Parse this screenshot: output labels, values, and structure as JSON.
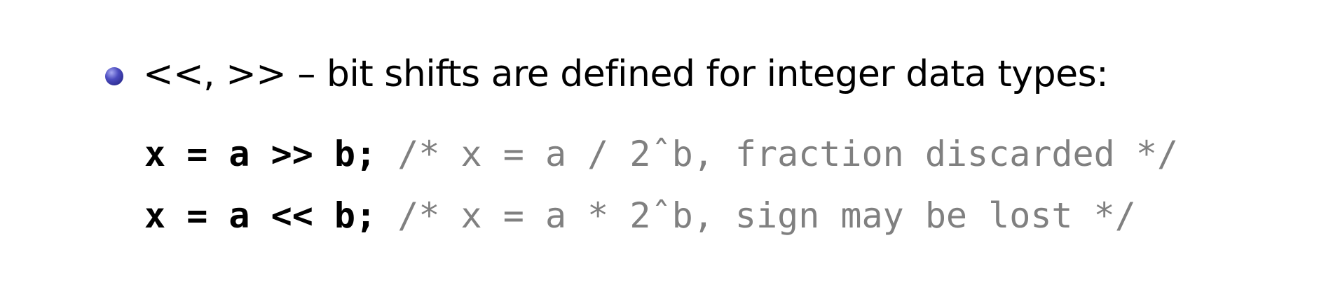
{
  "bullet": {
    "text": "<<, >> – bit shifts are defined for integer data types:"
  },
  "code_lines": [
    {
      "code": "x = a >> b;",
      "comment": "/* x = a / 2ˆb, fraction discarded */"
    },
    {
      "code": "x = a << b;",
      "comment": "/* x = a * 2ˆb, sign may be lost */"
    }
  ],
  "colors": {
    "bullet": "#3b3bb0",
    "code": "#000000",
    "comment": "#808080"
  },
  "icons": {
    "bullet": "bullet-circle-icon"
  }
}
